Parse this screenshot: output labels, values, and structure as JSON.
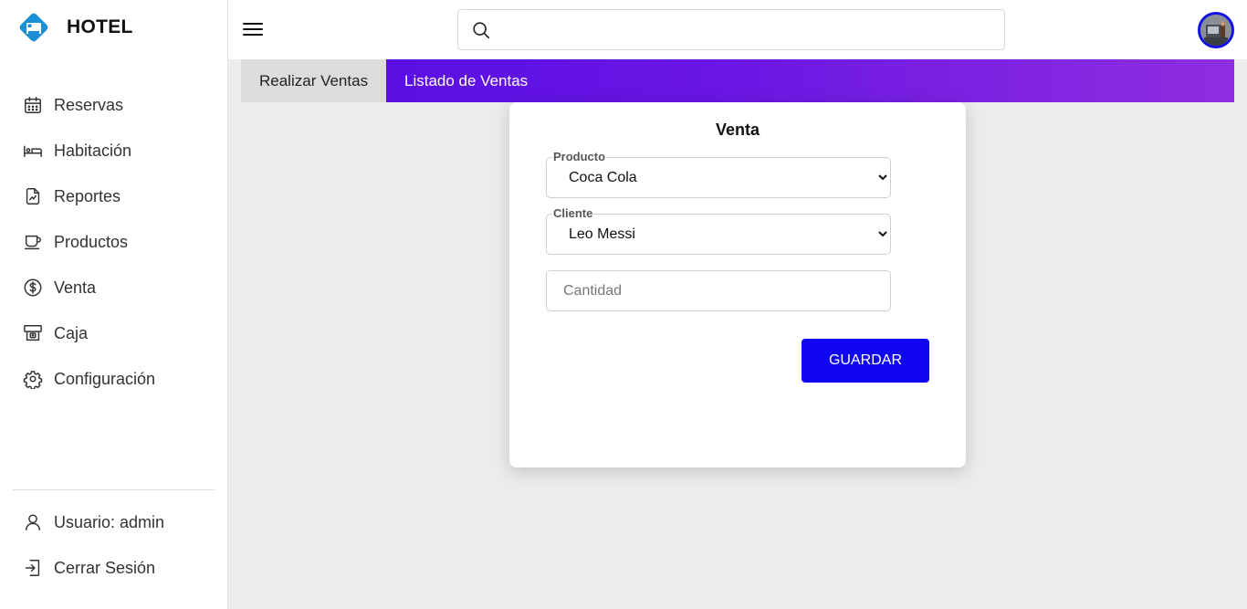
{
  "brand": {
    "name": "HOTEL",
    "logo_icon": "hotel-bed-logo",
    "accent": "#1a8fd6"
  },
  "sidebar": {
    "items": [
      {
        "label": "Reservas",
        "icon": "calendar-icon"
      },
      {
        "label": "Habitación",
        "icon": "bed-icon"
      },
      {
        "label": "Reportes",
        "icon": "report-icon"
      },
      {
        "label": "Productos",
        "icon": "cup-icon"
      },
      {
        "label": "Venta",
        "icon": "dollar-icon"
      },
      {
        "label": "Caja",
        "icon": "cash-register-icon"
      },
      {
        "label": "Configuración",
        "icon": "gear-icon"
      }
    ],
    "bottom": [
      {
        "label": "Usuario: admin",
        "icon": "user-icon"
      },
      {
        "label": "Cerrar Sesión",
        "icon": "logout-icon"
      }
    ]
  },
  "topbar": {
    "menu_icon": "hamburger-icon",
    "search_icon": "search-icon",
    "search_placeholder": "",
    "avatar_border": "#1212e8"
  },
  "tabs": [
    {
      "label": "Realizar Ventas",
      "active": false
    },
    {
      "label": "Listado de Ventas",
      "active": true
    }
  ],
  "form": {
    "title": "Venta",
    "producto": {
      "legend": "Producto",
      "selected": "Coca Cola"
    },
    "cliente": {
      "legend": "Cliente",
      "selected": "Leo Messi"
    },
    "cantidad": {
      "placeholder": "Cantidad",
      "value": ""
    },
    "submit_label": "GUARDAR",
    "submit_color": "#1006f2"
  }
}
